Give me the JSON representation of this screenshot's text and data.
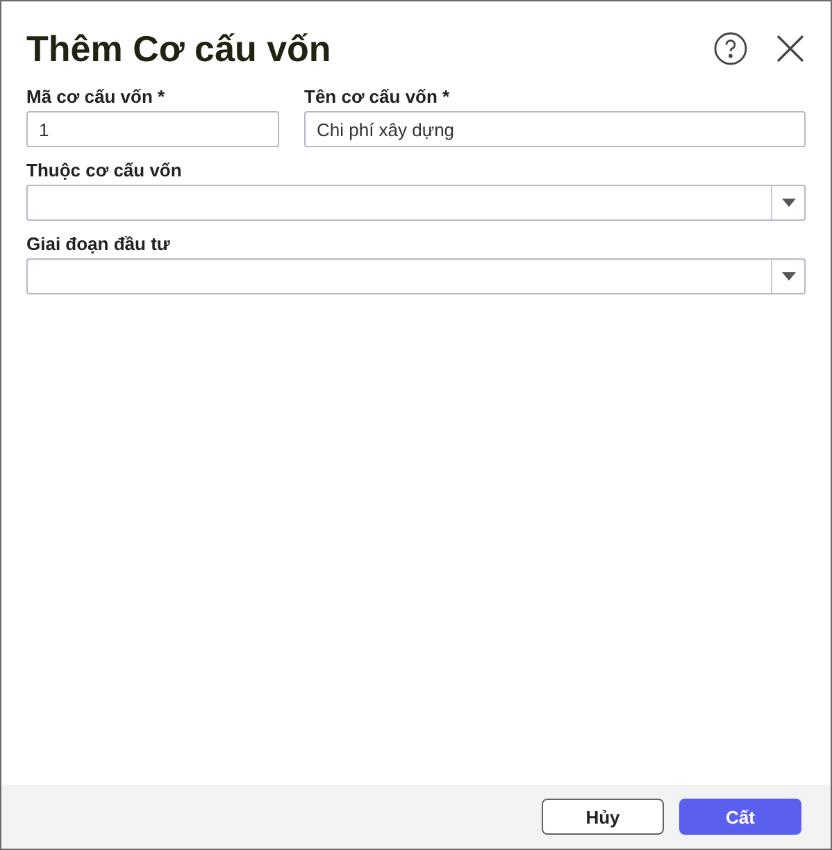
{
  "dialog": {
    "title": "Thêm Cơ cấu vốn"
  },
  "fields": [
    {
      "kind": "text",
      "label": "Mã cơ cấu vốn *",
      "value": "1"
    },
    {
      "kind": "text",
      "label": "Tên cơ cấu vốn *",
      "value": "Chi phí xây dựng"
    },
    {
      "kind": "select",
      "label": "Thuộc cơ cấu vốn"
    },
    {
      "kind": "select",
      "label": "Giai đoạn đầu tư"
    }
  ],
  "buttons": [
    {
      "label": "Hủy",
      "kind": "secondary"
    },
    {
      "label": "Cất",
      "kind": "primary"
    }
  ]
}
